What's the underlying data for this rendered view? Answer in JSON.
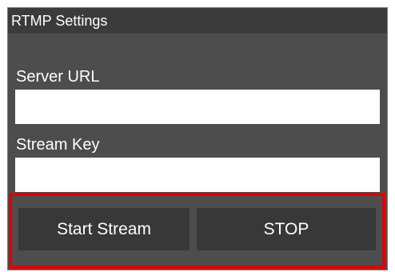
{
  "panel": {
    "title": "RTMP Settings"
  },
  "fields": {
    "server_url": {
      "label": "Server URL",
      "value": ""
    },
    "stream_key": {
      "label": "Stream Key",
      "value": ""
    }
  },
  "buttons": {
    "start_label": "Start Stream",
    "stop_label": "STOP"
  },
  "colors": {
    "panel_background": "#4d4d4d",
    "title_bar_background": "#3b3b3b",
    "button_background": "#383838",
    "highlight_border": "#e00000",
    "text": "#ffffff"
  }
}
